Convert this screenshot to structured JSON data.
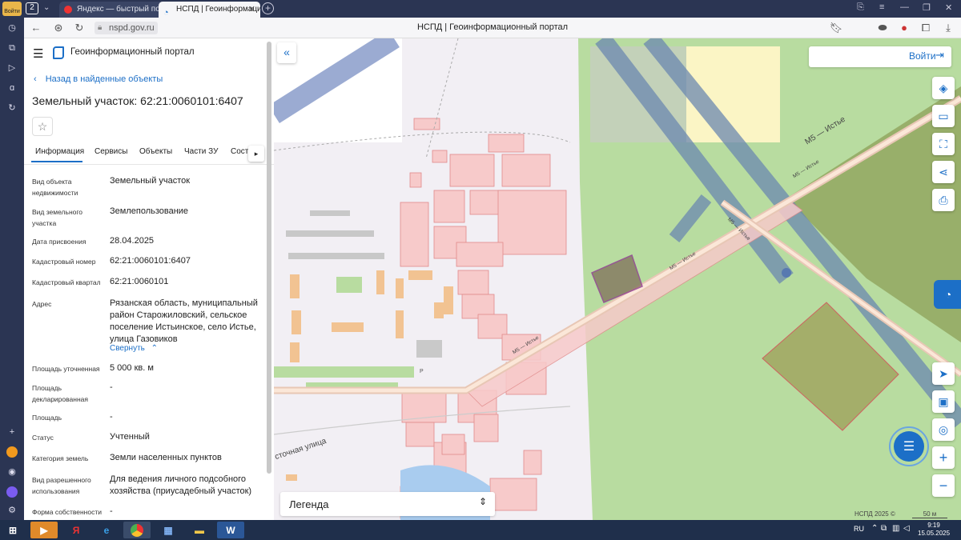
{
  "browser": {
    "login_label": "Войти",
    "tab_count": "2",
    "tabs": [
      {
        "label": "Яндекс — быстрый поиск"
      },
      {
        "label": "НСПД | Геоинформацио"
      }
    ],
    "url": "nspd.gov.ru",
    "page_title": "НСПД | Геоинформационный портал"
  },
  "panel": {
    "app_title": "Геоинформационный портал",
    "back_link": "Назад в найденные объекты",
    "heading": "Земельный участок: 62:21:0060101:6407",
    "tabs": [
      "Информация",
      "Сервисы",
      "Объекты",
      "Части ЗУ",
      "Соста"
    ],
    "fields": [
      {
        "label": "Вид объекта недвижимости",
        "value": "Земельный участок"
      },
      {
        "label": "Вид земельного участка",
        "value": "Землепользование"
      },
      {
        "label": "Дата присвоения",
        "value": "28.04.2025"
      },
      {
        "label": "Кадастровый номер",
        "value": "62:21:0060101:6407"
      },
      {
        "label": "Кадастровый квартал",
        "value": "62:21:0060101"
      },
      {
        "label": "Адрес",
        "value": "Рязанская область, муниципальный район Старожиловский, сельское поселение Истьинское, село Истье, улица Газовиков"
      },
      {
        "label": "Площадь уточненная",
        "value": "5 000 кв. м"
      },
      {
        "label": "Площадь декларированная",
        "value": "-"
      },
      {
        "label": "Площадь",
        "value": "-"
      },
      {
        "label": "Статус",
        "value": "Учтенный"
      },
      {
        "label": "Категория земель",
        "value": "Земли населенных пунктов"
      },
      {
        "label": "Вид разрешенного использования",
        "value": "Для ведения личного подсобного хозяйства (приусадебный участок)"
      },
      {
        "label": "Форма собственности",
        "value": "-"
      }
    ],
    "collapse_link": "Свернуть"
  },
  "map": {
    "login_button": "Войти",
    "road_labels": [
      "М5 — Истье",
      "М5 — Истье",
      "М5 — Истье",
      "М5 — Истье",
      "М5 — Истье"
    ],
    "street_label": "сточная улица",
    "parking_label": "P",
    "legend_label": "Легенда",
    "copyright": "НСПД 2025 ©",
    "scale_label": "50 м"
  },
  "taskbar": {
    "language": "RU",
    "time": "9:19",
    "date": "15.05.2025"
  }
}
